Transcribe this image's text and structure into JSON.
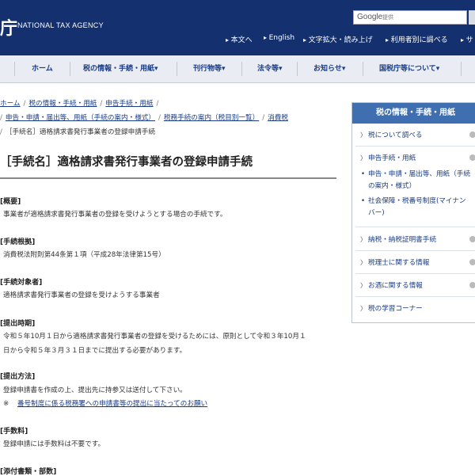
{
  "header": {
    "logo_kanji": "庁",
    "logo_en": "NATIONAL TAX AGENCY",
    "search": {
      "brand": "Google",
      "placeholder": "提供"
    },
    "utility_links": [
      "本文へ",
      "English",
      "文字拡大・読み上げ",
      "利用者別に調べる",
      "サ"
    ]
  },
  "nav": {
    "items": [
      "ホーム",
      "税の情報・手続・用紙▾",
      "刊行物等▾",
      "法令等▾",
      "お知らせ▾",
      "国税庁等について▾"
    ]
  },
  "breadcrumb": {
    "line1": [
      "ホーム",
      "税の情報・手続・用紙",
      "申告手続・用紙"
    ],
    "line2": [
      "申告・申請・届出等、用紙（手続の案内・様式）",
      "税務手続の案内（税目別一覧）",
      "消費税"
    ],
    "current": "［手続名］適格請求書発行事業者の登録申請手続"
  },
  "page": {
    "title": "［手続名］適格請求書発行事業者の登録申請手続",
    "sections": [
      {
        "heading": "概要",
        "body": "事業者が適格請求書発行事業者の登録を受けようとする場合の手続です。"
      },
      {
        "heading": "手続根拠",
        "body": "消費税法附則第44条第１項（平成28年法律第15号）"
      },
      {
        "heading": "手続対象者",
        "body": "適格請求書発行事業者の登録を受けようする事業者"
      },
      {
        "heading": "提出時期",
        "body_line1": "令和５年10月１日から適格請求書発行事業者の登録を受けるためには、原則として令和３年10月１",
        "body_line2": "日から令和５年３月３１日までに提出する必要があります。"
      },
      {
        "heading": "提出方法",
        "body": "登録申請書を作成の上、提出先に持参又は送付して下さい。",
        "note_mark": "※",
        "note_link": "番号制度に係る税務署への申請書等の提出に当たってのお願い"
      },
      {
        "heading": "手数料",
        "body": "登録申請には手数料は不要です。"
      },
      {
        "heading": "添付書類・部数",
        "body": ""
      }
    ]
  },
  "sidebar": {
    "title": "税の情報・手続・用紙",
    "items": [
      "税について調べる",
      "申告手続・用紙",
      "納税・納税証明書手続",
      "税理士に関する情報",
      "お酒に関する情報",
      "税の学習コーナー"
    ],
    "subitems": [
      "申告・申請・届出等、用紙（手続の案内・様式）",
      "社会保障・税番号制度(マイナンバー)"
    ]
  }
}
